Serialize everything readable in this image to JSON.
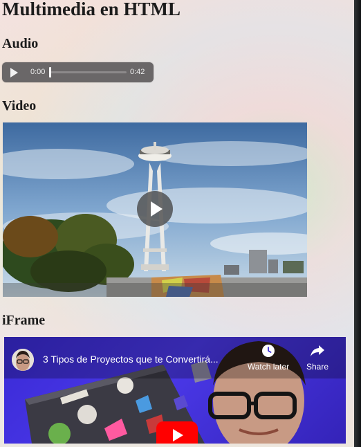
{
  "page": {
    "title": "Multimedia en HTML"
  },
  "sections": {
    "audio_heading": "Audio",
    "video_heading": "Video",
    "iframe_heading": "iFrame"
  },
  "audio_player": {
    "current_time": "0:00",
    "duration": "0:42",
    "progress": 0
  },
  "video_player": {
    "play_icon": "play-icon"
  },
  "youtube_embed": {
    "title": "3 Tipos de Proyectos que te Convertirá...",
    "watch_later_label": "Watch later",
    "share_label": "Share",
    "watch_later_icon": "clock-icon",
    "share_icon": "share-arrow-icon",
    "play_icon": "youtube-play-icon",
    "brand_color": "#ff0000",
    "background_color": "#3a2ad6"
  }
}
